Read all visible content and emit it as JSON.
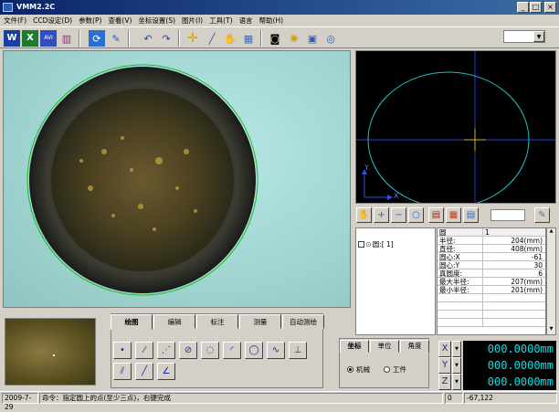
{
  "window": {
    "title": "VMM2.2C",
    "min": "_",
    "max": "□",
    "close": "×"
  },
  "menu": [
    "文件(F)",
    "CCD设定(D)",
    "参数(P)",
    "查看(V)",
    "坐标设置(S)",
    "图片(I)",
    "工具(T)",
    "语言",
    "帮助(H)"
  ],
  "toolbar": {
    "word": "W",
    "excel": "X",
    "avi": "AVI",
    "chart": "▥",
    "refresh": "⟳",
    "edit": "✎",
    "undo": "↶",
    "redo": "↷",
    "crosshair": "✛",
    "pen": "╱",
    "hand": "✋",
    "grid": "▦",
    "camera": "◙",
    "light": "✺",
    "window": "▣",
    "target": "◎"
  },
  "graph": {
    "y_label": "Y",
    "x_label": "X"
  },
  "graph_tools": {
    "hand": "✋",
    "zoom_in": "+",
    "zoom_out": "−",
    "zoom_fit": "○",
    "book": "▤",
    "grid4": "▦",
    "table": "▤",
    "pencil": "✎"
  },
  "tree": {
    "node_label": "圆:[ 1]"
  },
  "props": {
    "header": {
      "name": "圆",
      "value": "1"
    },
    "rows": [
      {
        "k": "半径:",
        "v": "204(mm)"
      },
      {
        "k": "直径:",
        "v": "408(mm)"
      },
      {
        "k": "圆心:X",
        "v": "-61"
      },
      {
        "k": "圆心:Y",
        "v": "30"
      },
      {
        "k": "真圆度:",
        "v": "6"
      },
      {
        "k": "最大半径:",
        "v": "207(mm)"
      },
      {
        "k": "最小半径:",
        "v": "201(mm)"
      }
    ]
  },
  "tabs": [
    "绘图",
    "编辑",
    "标注",
    "测量",
    "自动测绘"
  ],
  "draw_tools": [
    "•",
    "⁄",
    "⋰",
    "⊘",
    "◌",
    "◜",
    "◯",
    "∿",
    "⊥",
    "⫽",
    "╱",
    "∠"
  ],
  "coord": {
    "tabs": [
      "坐标",
      "单位",
      "角度"
    ],
    "machine": "机械",
    "workpiece": "工件"
  },
  "axes": [
    {
      "label": "X",
      "value": "000.0000mm"
    },
    {
      "label": "Y",
      "value": "000.0000mm"
    },
    {
      "label": "Z",
      "value": "000.0000mm"
    }
  ],
  "status": {
    "date": "2009-7-29",
    "message": "命令：指定圆上的点(至少三点)，右键完成",
    "zero": "0",
    "coords": "-67,122"
  }
}
